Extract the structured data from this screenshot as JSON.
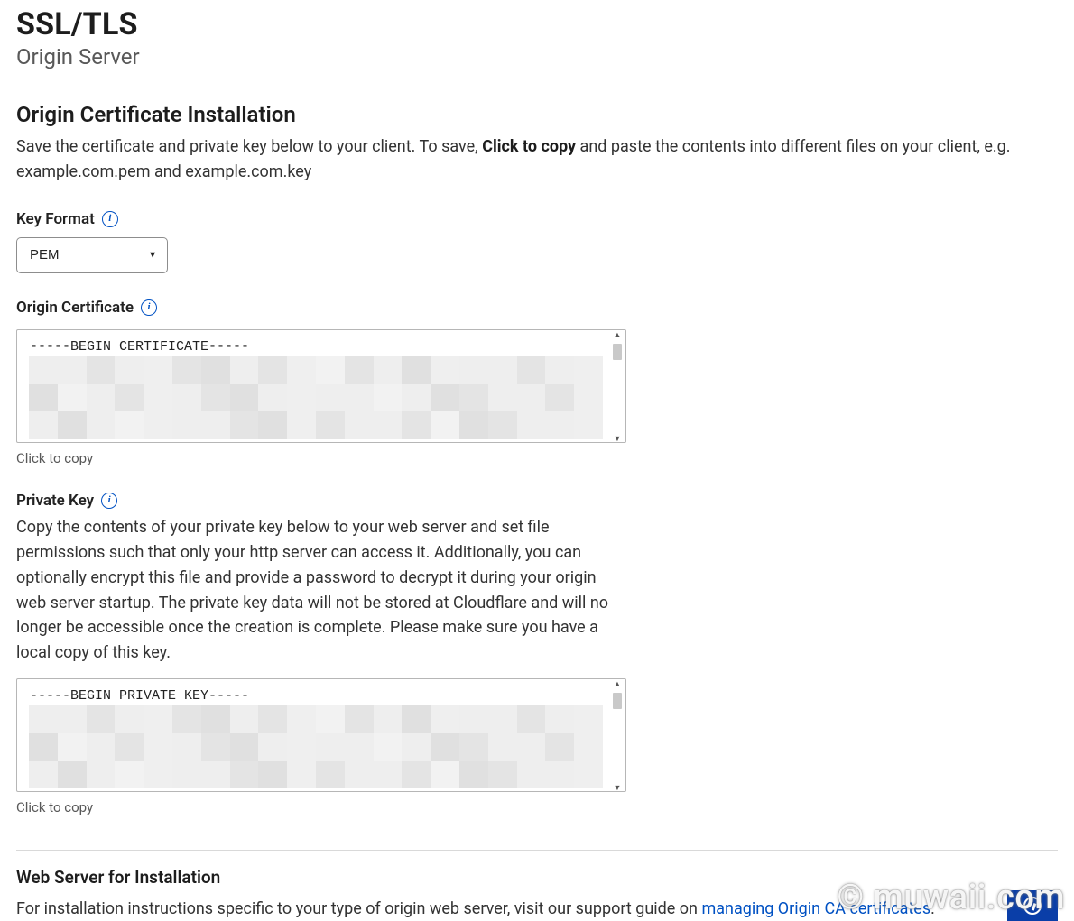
{
  "header": {
    "title": "SSL/TLS",
    "subtitle": "Origin Server"
  },
  "section": {
    "heading": "Origin Certificate Installation",
    "intro_before_bold": "Save the certificate and private key below to your client. To save, ",
    "intro_bold": "Click to copy",
    "intro_after_bold": " and paste the contents into different files on your client, e.g. example.com.pem and example.com.key"
  },
  "key_format": {
    "label": "Key Format",
    "value": "PEM"
  },
  "origin_cert": {
    "label": "Origin Certificate",
    "content": "-----BEGIN CERTIFICATE-----",
    "copy_hint": "Click to copy"
  },
  "private_key": {
    "label": "Private Key",
    "description": "Copy the contents of your private key below to your web server and set file permissions such that only your http server can access it. Additionally, you can optionally encrypt this file and provide a password to decrypt it during your origin web server startup. The private key data will not be stored at Cloudflare and will no longer be accessible once the creation is complete. Please make sure you have a local copy of this key.",
    "content": "-----BEGIN PRIVATE KEY-----",
    "copy_hint": "Click to copy"
  },
  "install": {
    "heading": "Web Server for Installation",
    "text_before_link": "For installation instructions specific to your type of origin web server, visit our support guide on ",
    "link_text": "managing Origin CA certificates",
    "text_after_link": "."
  },
  "watermark": "© muwaii.com"
}
